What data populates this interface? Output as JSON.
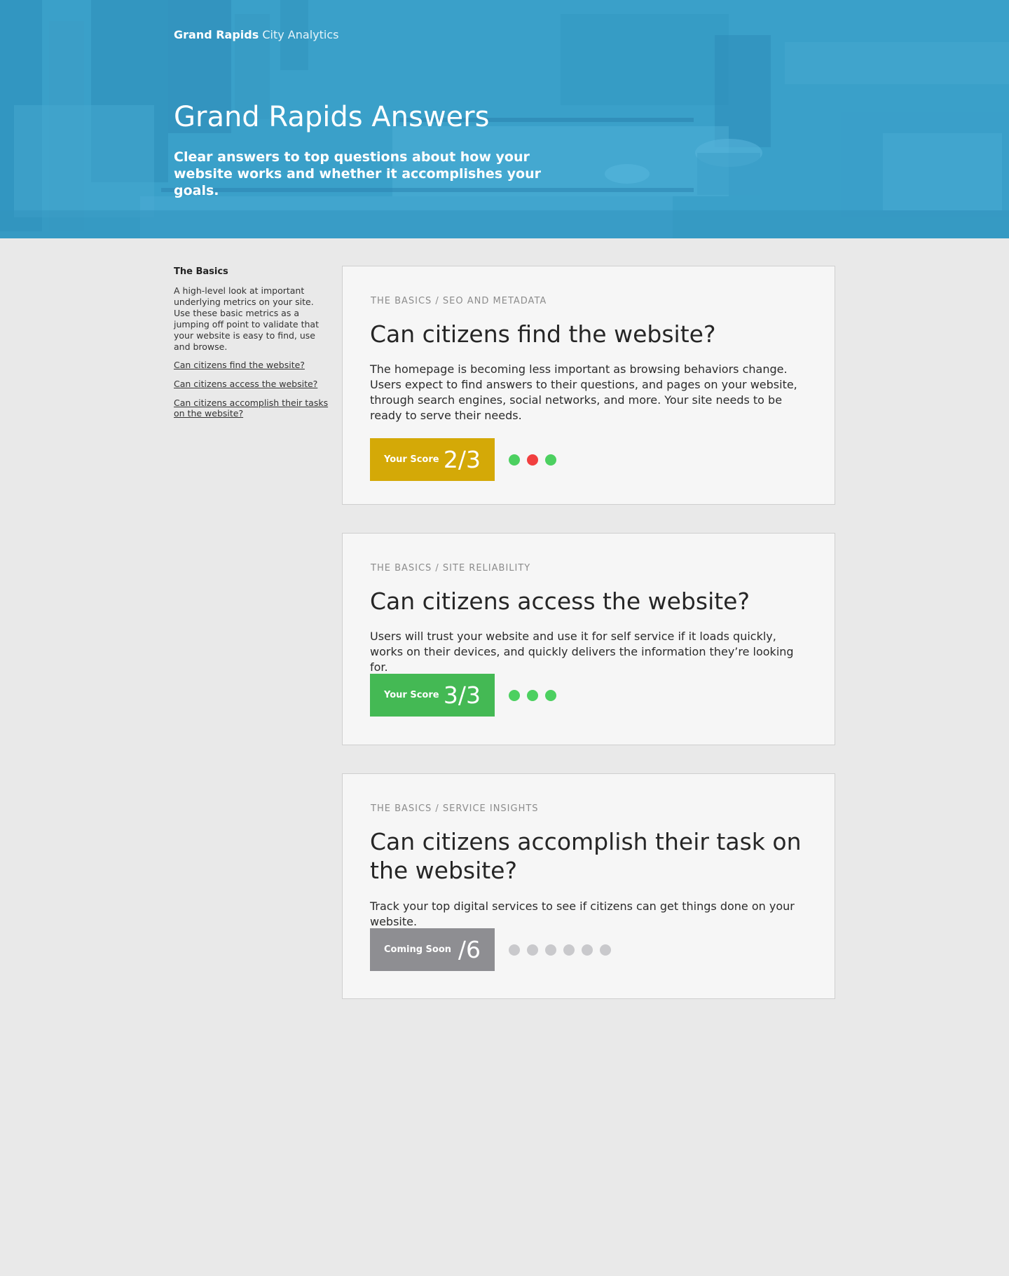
{
  "header": {
    "brand_strong": "Grand Rapids",
    "brand_light": "City Analytics",
    "title": "Grand Rapids Answers",
    "subtitle": "Clear answers to top questions about how your website works and whether it accomplishes your goals."
  },
  "sidebar": {
    "title": "The Basics",
    "description": "A high-level look at important underlying metrics on your site. Use these basic metrics as a jumping off point to validate that your website is easy to find, use and browse.",
    "links": [
      "Can citizens find the website?",
      "Can citizens access the website?",
      "Can citizens accomplish their tasks on the website?"
    ]
  },
  "cards": [
    {
      "crumb": "THE BASICS / SEO AND METADATA",
      "title": "Can citizens find the website?",
      "body": "The homepage is becoming less important as browsing behaviors change. Users expect to find answers to their questions, and pages on your website, through search engines, social networks, and more. Your site needs to be ready to serve their needs.",
      "score_label": "Your Score",
      "score_value": "2/3",
      "score_color": "#d4a907",
      "dots": [
        "pass",
        "fail",
        "pass"
      ]
    },
    {
      "crumb": "THE BASICS / SITE RELIABILITY",
      "title": "Can citizens access the website?",
      "body": "Users will trust your website and use it for self service if it loads quickly, works on their devices, and quickly delivers the information they’re looking for.",
      "score_label": "Your Score",
      "score_value": "3/3",
      "score_color": "#44b954",
      "dots": [
        "pass",
        "pass",
        "pass"
      ]
    },
    {
      "crumb": "THE BASICS / SERVICE INSIGHTS",
      "title": "Can citizens accomplish their task on the website?",
      "body": "Track your top digital services to see if citizens can get things done on your website.",
      "score_label": "Coming Soon",
      "score_value": "/6",
      "score_color": "#8e8e92",
      "dots": [
        "pending",
        "pending",
        "pending",
        "pending",
        "pending",
        "pending"
      ]
    }
  ],
  "colors": {
    "hero": "#3aa0c9",
    "pass": "#4cd060",
    "fail": "#f13f3f",
    "pending": "#c9c9cc"
  }
}
